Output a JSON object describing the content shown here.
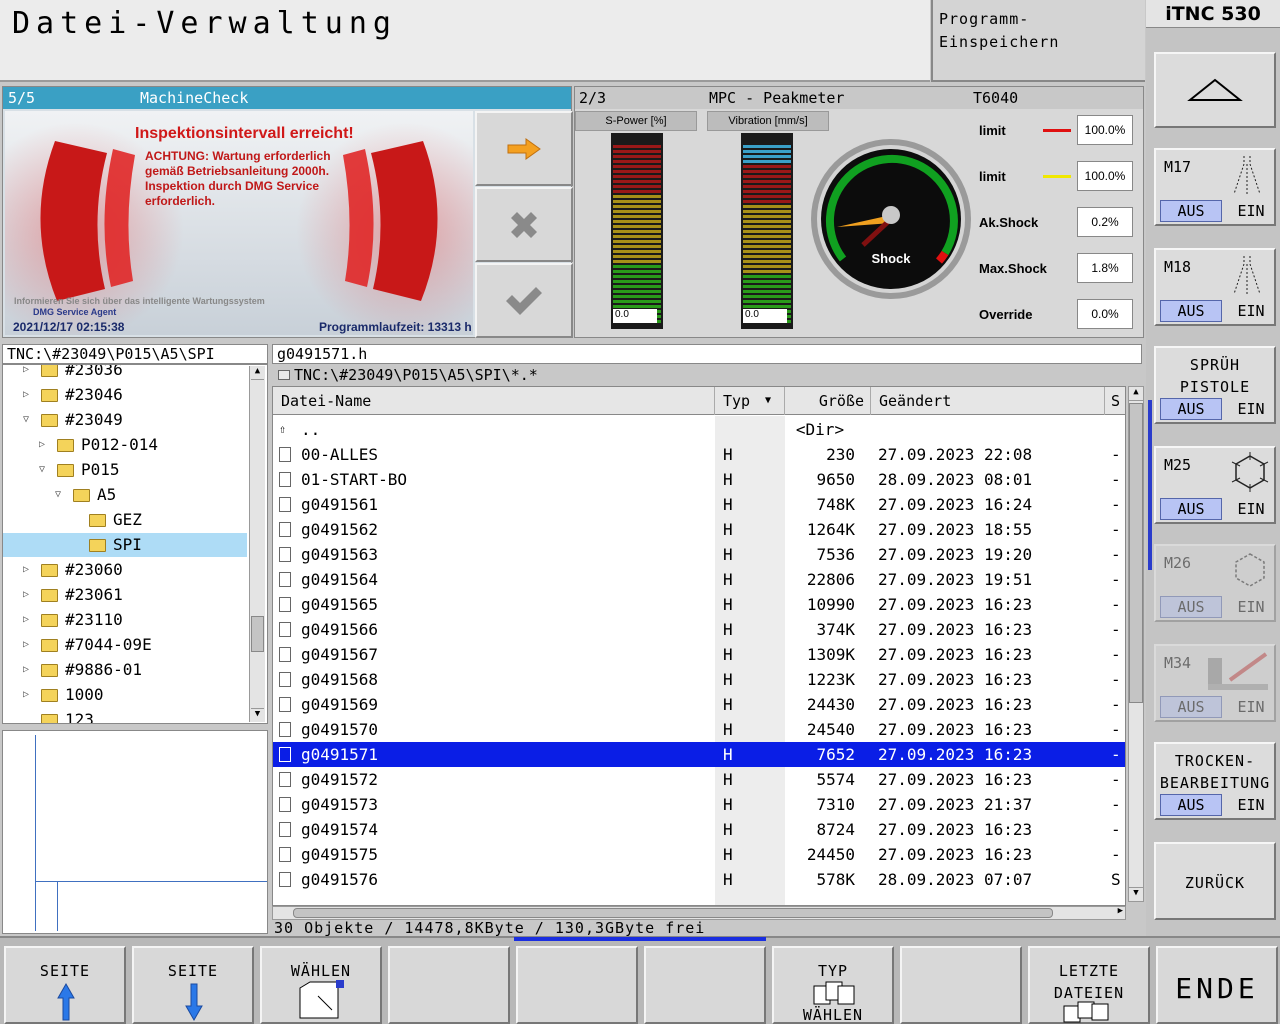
{
  "header": {
    "title": "Datei-Verwaltung",
    "mode_line1": "Programm-",
    "mode_line2": "Einspeichern",
    "control": "iTNC 530"
  },
  "machinecheck": {
    "page": "5/5",
    "title": "MachineCheck",
    "heading": "Inspektionsintervall erreicht!",
    "lines": [
      "ACHTUNG: Wartung erforderlich",
      "gemäß Betriebsanleitung 2000h.",
      "Inspektion durch DMG Service",
      "erforderlich."
    ],
    "info": "Informieren Sie sich über das intelligente Wartungssystem",
    "agent": "DMG Service Agent",
    "datetime": "2021/12/17 02:15:38",
    "runtime": "Programmlaufzeit: 13313 h",
    "buttons": [
      "arrow-right-icon",
      "close-icon",
      "check-icon"
    ]
  },
  "peakmeter": {
    "page": "2/3",
    "title": "MPC - Peakmeter",
    "tool": "T6040",
    "meter1": {
      "label": "S-Power [%]",
      "value": "0.0"
    },
    "meter2": {
      "label": "Vibration [mm/s]",
      "value": "0.0"
    },
    "gauge_label": "Shock",
    "rows": [
      {
        "label": "limit",
        "color": "#e01010",
        "value": "100.0%"
      },
      {
        "label": "limit",
        "color": "#f0e800",
        "value": "100.0%"
      },
      {
        "label": "Ak.Shock",
        "color": "",
        "value": "0.2%"
      },
      {
        "label": "Max.Shock",
        "color": "",
        "value": "1.8%"
      },
      {
        "label": "Override",
        "color": "",
        "value": "0.0%"
      }
    ]
  },
  "tree": {
    "path": "TNC:\\#23049\\P015\\A5\\SPI",
    "items": [
      {
        "name": "#23036",
        "level": 0,
        "arrow": "▷"
      },
      {
        "name": "#23046",
        "level": 0,
        "arrow": "▷"
      },
      {
        "name": "#23049",
        "level": 0,
        "arrow": "▽"
      },
      {
        "name": "P012-014",
        "level": 1,
        "arrow": "▷"
      },
      {
        "name": "P015",
        "level": 1,
        "arrow": "▽"
      },
      {
        "name": "A5",
        "level": 2,
        "arrow": "▽"
      },
      {
        "name": "GEZ",
        "level": 3,
        "arrow": ""
      },
      {
        "name": "SPI",
        "level": 3,
        "arrow": ""
      },
      {
        "name": "#23060",
        "level": 0,
        "arrow": "▷"
      },
      {
        "name": "#23061",
        "level": 0,
        "arrow": "▷"
      },
      {
        "name": "#23110",
        "level": 0,
        "arrow": "▷"
      },
      {
        "name": "#7044-09E",
        "level": 0,
        "arrow": "▷"
      },
      {
        "name": "#9886-01",
        "level": 0,
        "arrow": "▷"
      },
      {
        "name": "1000",
        "level": 0,
        "arrow": "▷"
      },
      {
        "name": "123",
        "level": 0,
        "arrow": ""
      }
    ]
  },
  "files": {
    "current_name": "g0491571.h",
    "path": "TNC:\\#23049\\P015\\A5\\SPI\\*.*",
    "columns": [
      "Datei-Name",
      "Typ",
      "Größe",
      "Geändert",
      "S"
    ],
    "rows": [
      {
        "name": "..",
        "typ": "",
        "size": "<Dir>",
        "changed": "",
        "s": ""
      },
      {
        "name": "00-ALLES",
        "typ": "H",
        "size": "230",
        "changed": "27.09.2023 22:08",
        "s": "-"
      },
      {
        "name": "01-START-BO",
        "typ": "H",
        "size": "9650",
        "changed": "28.09.2023 08:01",
        "s": "-"
      },
      {
        "name": "g0491561",
        "typ": "H",
        "size": "748K",
        "changed": "27.09.2023 16:24",
        "s": "-"
      },
      {
        "name": "g0491562",
        "typ": "H",
        "size": "1264K",
        "changed": "27.09.2023 18:55",
        "s": "-"
      },
      {
        "name": "g0491563",
        "typ": "H",
        "size": "7536",
        "changed": "27.09.2023 19:20",
        "s": "-"
      },
      {
        "name": "g0491564",
        "typ": "H",
        "size": "22806",
        "changed": "27.09.2023 19:51",
        "s": "-"
      },
      {
        "name": "g0491565",
        "typ": "H",
        "size": "10990",
        "changed": "27.09.2023 16:23",
        "s": "-"
      },
      {
        "name": "g0491566",
        "typ": "H",
        "size": "374K",
        "changed": "27.09.2023 16:23",
        "s": "-"
      },
      {
        "name": "g0491567",
        "typ": "H",
        "size": "1309K",
        "changed": "27.09.2023 16:23",
        "s": "-"
      },
      {
        "name": "g0491568",
        "typ": "H",
        "size": "1223K",
        "changed": "27.09.2023 16:23",
        "s": "-"
      },
      {
        "name": "g0491569",
        "typ": "H",
        "size": "24430",
        "changed": "27.09.2023 16:23",
        "s": "-"
      },
      {
        "name": "g0491570",
        "typ": "H",
        "size": "24540",
        "changed": "27.09.2023 16:23",
        "s": "-"
      },
      {
        "name": "g0491571",
        "typ": "H",
        "size": "7652",
        "changed": "27.09.2023 16:23",
        "s": "-"
      },
      {
        "name": "g0491572",
        "typ": "H",
        "size": "5574",
        "changed": "27.09.2023 16:23",
        "s": "-"
      },
      {
        "name": "g0491573",
        "typ": "H",
        "size": "7310",
        "changed": "27.09.2023 21:37",
        "s": "-"
      },
      {
        "name": "g0491574",
        "typ": "H",
        "size": "8724",
        "changed": "27.09.2023 16:23",
        "s": "-"
      },
      {
        "name": "g0491575",
        "typ": "H",
        "size": "24450",
        "changed": "27.09.2023 16:23",
        "s": "-"
      },
      {
        "name": "g0491576",
        "typ": "H",
        "size": "578K",
        "changed": "28.09.2023 07:07",
        "s": "S"
      }
    ],
    "selected_index": 13,
    "status": "30 Objekte / 14478,8KByte / 130,3GByte frei"
  },
  "right_softkeys": {
    "up": "arrow-up-icon",
    "m17": {
      "label": "M17",
      "aus": "AUS",
      "ein": "EIN"
    },
    "m18": {
      "label": "M18",
      "aus": "AUS",
      "ein": "EIN"
    },
    "spruh": {
      "line1": "SPRÜH",
      "line2": "PISTOLE",
      "aus": "AUS",
      "ein": "EIN"
    },
    "m25": {
      "label": "M25",
      "aus": "AUS",
      "ein": "EIN"
    },
    "m26": {
      "label": "M26",
      "aus": "AUS",
      "ein": "EIN"
    },
    "m34": {
      "label": "M34",
      "aus": "AUS",
      "ein": "EIN"
    },
    "trocken": {
      "line1": "TROCKEN-",
      "line2": "BEARBEITUNG",
      "aus": "AUS",
      "ein": "EIN"
    },
    "zurueck": "ZURÜCK"
  },
  "bottom_softkeys": {
    "seite_up": "SEITE",
    "seite_down": "SEITE",
    "waehlen": "WÄHLEN",
    "typ_l1": "TYP",
    "typ_l2": "WÄHLEN",
    "letzte_l1": "LETZTE",
    "letzte_l2": "DATEIEN",
    "ende": "ENDE"
  }
}
